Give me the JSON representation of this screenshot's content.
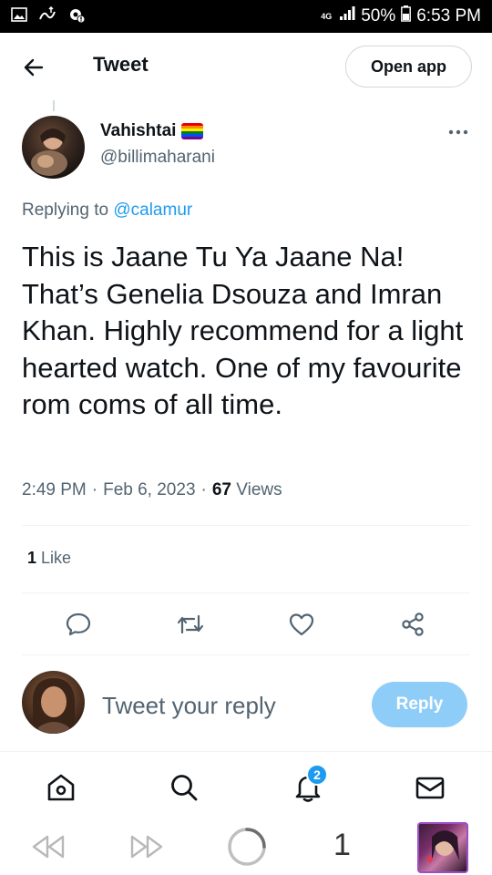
{
  "status_bar": {
    "network": "4G",
    "battery": "50%",
    "time": "6:53 PM"
  },
  "header": {
    "title": "Tweet",
    "open_app": "Open app"
  },
  "tweet": {
    "author_name": "Vahishtai",
    "author_handle": "@billimaharani",
    "replying_to_label": "Replying to",
    "replying_to_handle": "@calamur",
    "text": "This is Jaane Tu Ya Jaane Na! That’s Genelia Dsouza and Imran Khan. Highly recommend for a light hearted watch. One of my favourite rom coms of all time.",
    "time": "2:49 PM",
    "date": "Feb 6, 2023",
    "separator": "·",
    "views_count": "67",
    "views_label": "Views",
    "likes_count": "1",
    "likes_label": "Like"
  },
  "reply_box": {
    "placeholder": "Tweet your reply",
    "button": "Reply"
  },
  "bottom_nav": {
    "notification_count": "2"
  },
  "browser": {
    "tab_count": "1"
  },
  "colors": {
    "accent": "#1d9bf0",
    "reply_button_disabled": "#8ecdf8",
    "secondary_text": "#536471",
    "primary_text": "#0f1419"
  },
  "icons": {
    "back": "arrow-left-icon",
    "more": "more-horizontal-icon",
    "reply": "comment-icon",
    "retweet": "retweet-icon",
    "like": "heart-icon",
    "share": "share-icon",
    "home": "home-icon",
    "search": "search-icon",
    "notifications": "bell-icon",
    "messages": "mail-icon"
  }
}
